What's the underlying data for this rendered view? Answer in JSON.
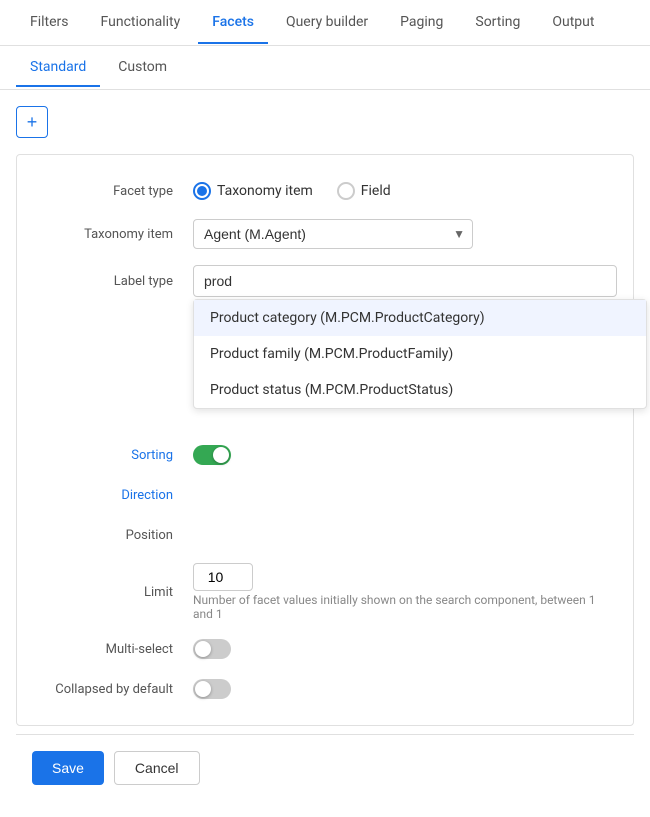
{
  "nav": {
    "items": [
      {
        "label": "Filters",
        "active": false
      },
      {
        "label": "Functionality",
        "active": false
      },
      {
        "label": "Facets",
        "active": true
      },
      {
        "label": "Query builder",
        "active": false
      },
      {
        "label": "Paging",
        "active": false
      },
      {
        "label": "Sorting",
        "active": false
      },
      {
        "label": "Output",
        "active": false
      }
    ]
  },
  "subtabs": {
    "items": [
      {
        "label": "Standard",
        "active": true
      },
      {
        "label": "Custom",
        "active": false
      }
    ]
  },
  "add_button": "+",
  "form": {
    "facet_type_label": "Facet type",
    "facet_type_option1": "Taxonomy item",
    "facet_type_option2": "Field",
    "taxonomy_item_label": "Taxonomy item",
    "taxonomy_item_value": "Agent (M.Agent)",
    "label_type_label": "Label type",
    "search_placeholder": "prod",
    "sorting_label": "Sorting",
    "direction_label": "Direction",
    "position_label": "Position",
    "limit_label": "Limit",
    "limit_value": "10",
    "limit_help": "Number of facet values initially shown on the search component, between 1 and 1",
    "multiselect_label": "Multi-select",
    "collapsed_label": "Collapsed by default",
    "dropdown_items": [
      {
        "label": "Product category (M.PCM.ProductCategory)"
      },
      {
        "label": "Product family (M.PCM.ProductFamily)"
      },
      {
        "label": "Product status (M.PCM.ProductStatus)"
      }
    ]
  },
  "buttons": {
    "save": "Save",
    "cancel": "Cancel"
  }
}
